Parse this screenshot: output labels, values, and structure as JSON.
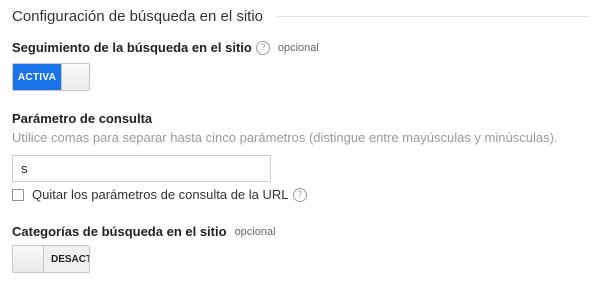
{
  "section": {
    "title": "Configuración de búsqueda en el sitio"
  },
  "site_search_tracking": {
    "label": "Seguimiento de la búsqueda en el sitio",
    "help_icon": "question-circle-icon",
    "help_glyph": "?",
    "optional": "opcional",
    "toggle_state": "on",
    "toggle_label": "ACTIVA"
  },
  "query_parameter": {
    "label": "Parámetro de consulta",
    "description": "Utilice comas para separar hasta cinco parámetros (distingue entre mayúsculas y minúsculas).",
    "value": "s",
    "strip_checkbox": {
      "checked": false,
      "label": "Quitar los parámetros de consulta de la URL",
      "help_icon": "question-circle-icon",
      "help_glyph": "?"
    }
  },
  "site_search_categories": {
    "label": "Categorías de búsqueda en el sitio",
    "optional": "opcional",
    "toggle_state": "off",
    "toggle_label": "DESACT"
  },
  "colors": {
    "accent": "#1a73e8",
    "divider": "#e6e6e6",
    "muted_text": "#9a9a9a"
  }
}
